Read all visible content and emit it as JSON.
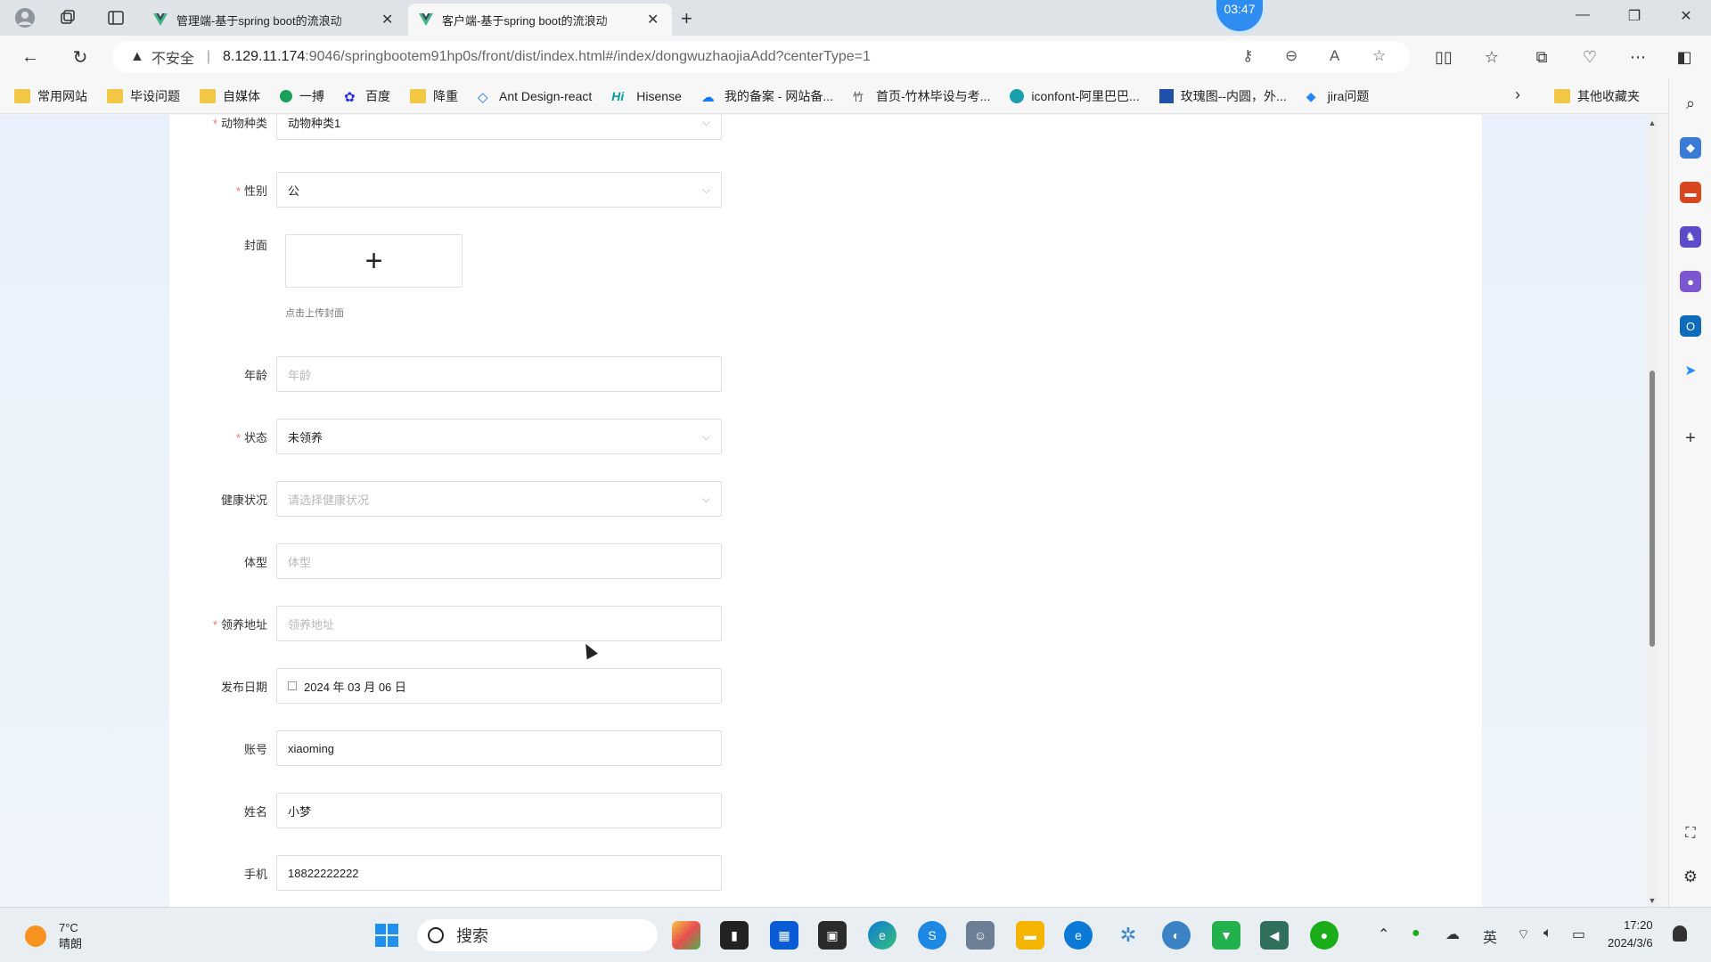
{
  "browser": {
    "tabs": [
      {
        "title": "管理端-基于spring boot的流浪动",
        "active": false
      },
      {
        "title": "客户端-基于spring boot的流浪动",
        "active": true
      }
    ],
    "timer_badge": "03:47",
    "address": {
      "security": "不安全",
      "host": "8.129.11.174",
      "path": ":9046/springbootem91hp0s/front/dist/index.html#/index/dongwuzhaojiaAdd?centerType=1"
    },
    "bookmarks": [
      {
        "label": "常用网站",
        "icon": "folder-icon"
      },
      {
        "label": "毕设问题",
        "icon": "folder-icon"
      },
      {
        "label": "自媒体",
        "icon": "folder-icon"
      },
      {
        "label": "一搏",
        "icon": "site-icon"
      },
      {
        "label": "百度",
        "icon": "baidu-icon"
      },
      {
        "label": "降重",
        "icon": "folder-icon"
      },
      {
        "label": "Ant Design-react",
        "icon": "antd-icon"
      },
      {
        "label": "Hisense",
        "icon": "hisense-icon"
      },
      {
        "label": "我的备案 - 网站备...",
        "icon": "cloud-icon"
      },
      {
        "label": "首页-竹林毕设与考...",
        "icon": "site-icon"
      },
      {
        "label": "iconfont-阿里巴巴...",
        "icon": "iconfont-icon"
      },
      {
        "label": "玫瑰图--内圆，外...",
        "icon": "chart-icon"
      },
      {
        "label": "jira问题",
        "icon": "jira-icon"
      }
    ],
    "other_bookmarks": "其他收藏夹"
  },
  "form": {
    "species": {
      "label": "动物种类",
      "value": "动物种类1",
      "required": true
    },
    "gender": {
      "label": "性别",
      "value": "公",
      "required": true
    },
    "cover": {
      "label": "封面",
      "tip": "点击上传封面"
    },
    "age": {
      "label": "年龄",
      "placeholder": "年龄"
    },
    "status": {
      "label": "状态",
      "value": "未领养",
      "required": true
    },
    "health": {
      "label": "健康状况",
      "placeholder": "请选择健康状况"
    },
    "body": {
      "label": "体型",
      "placeholder": "体型"
    },
    "address": {
      "label": "领养地址",
      "placeholder": "领养地址",
      "required": true
    },
    "publish_date": {
      "label": "发布日期",
      "value": "2024 年 03 月 06 日"
    },
    "account": {
      "label": "账号",
      "value": "xiaoming"
    },
    "name": {
      "label": "姓名",
      "value": "小梦"
    },
    "phone": {
      "label": "手机",
      "value": "18822222222"
    }
  },
  "taskbar": {
    "weather": {
      "temp": "7°C",
      "desc": "晴朗"
    },
    "search_label": "搜索",
    "ime": "英",
    "time": "17:20",
    "date": "2024/3/6"
  },
  "colors": {
    "required_mark": "#f56c6c",
    "accent": "#2f8cf1"
  }
}
